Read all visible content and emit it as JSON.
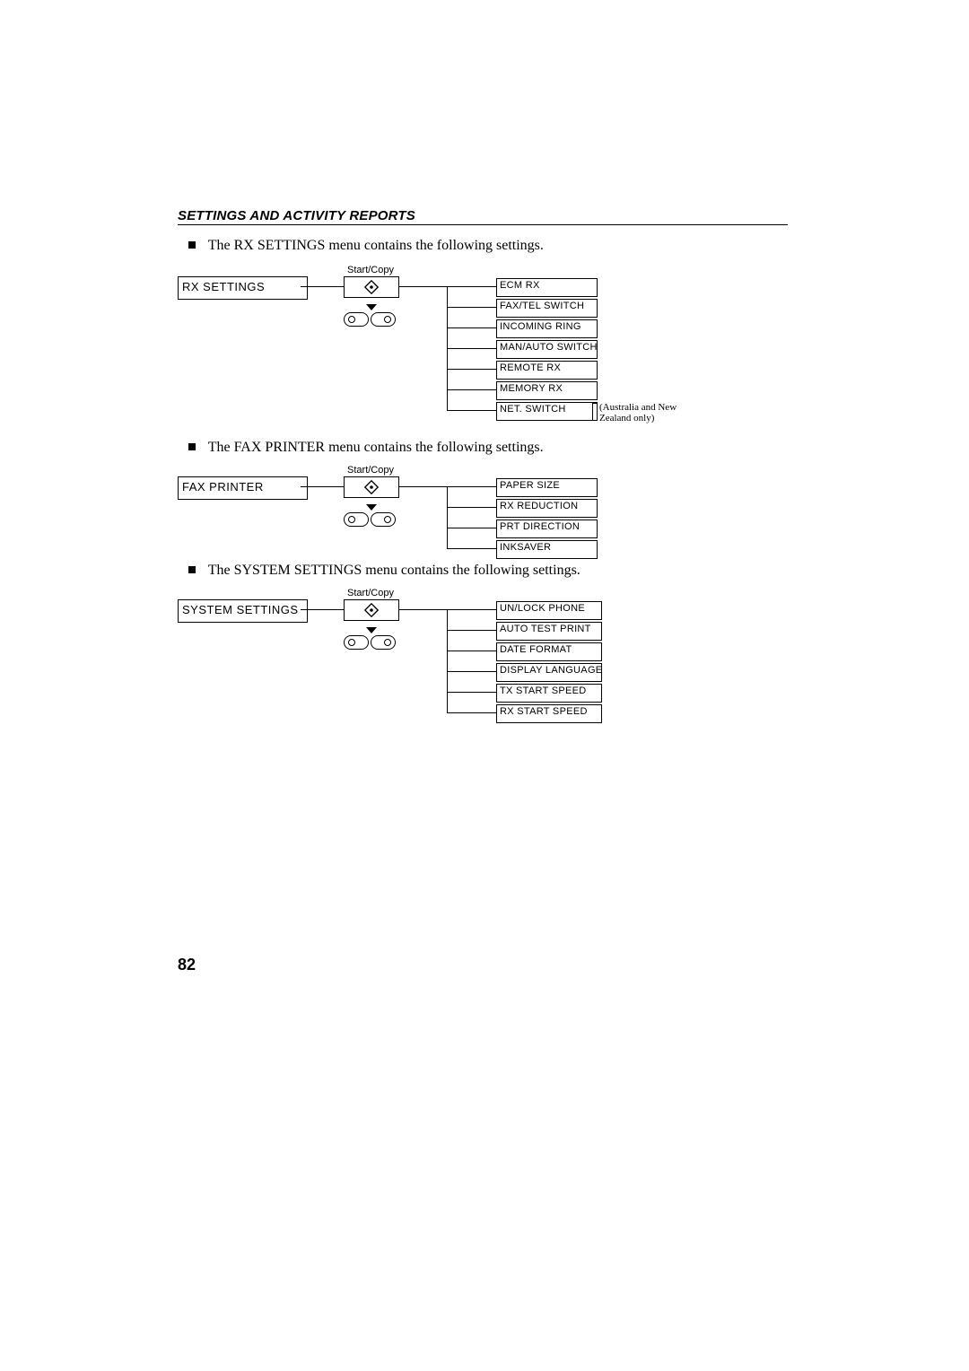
{
  "header": "SETTINGS AND ACTIVITY REPORTS",
  "page_number": "82",
  "start_copy_label": "Start/Copy",
  "sections": [
    {
      "bullet": "The RX SETTINGS menu contains the following settings.",
      "menu": "RX  SETTINGS",
      "options": [
        "ECM  RX",
        "FAX/TEL  SWITCH",
        "INCOMING  RING",
        "MAN/AUTO  SWITCH",
        "REMOTE  RX",
        "MEMORY  RX",
        "NET.  SWITCH"
      ],
      "note": "(Australia and New Zealand only)"
    },
    {
      "bullet": "The FAX PRINTER menu contains the following settings.",
      "menu": "FAX  PRINTER",
      "options": [
        "PAPER  SIZE",
        "RX  REDUCTION",
        "PRT  DIRECTION",
        "INKSAVER"
      ]
    },
    {
      "bullet": "The SYSTEM SETTINGS menu contains the following settings.",
      "menu": "SYSTEM  SETTINGS",
      "options": [
        "UN/LOCK  PHONE",
        "AUTO  TEST  PRINT",
        "DATE  FORMAT",
        "DISPLAY  LANGUAGE",
        "TX  START  SPEED",
        "RX  START  SPEED"
      ]
    }
  ]
}
